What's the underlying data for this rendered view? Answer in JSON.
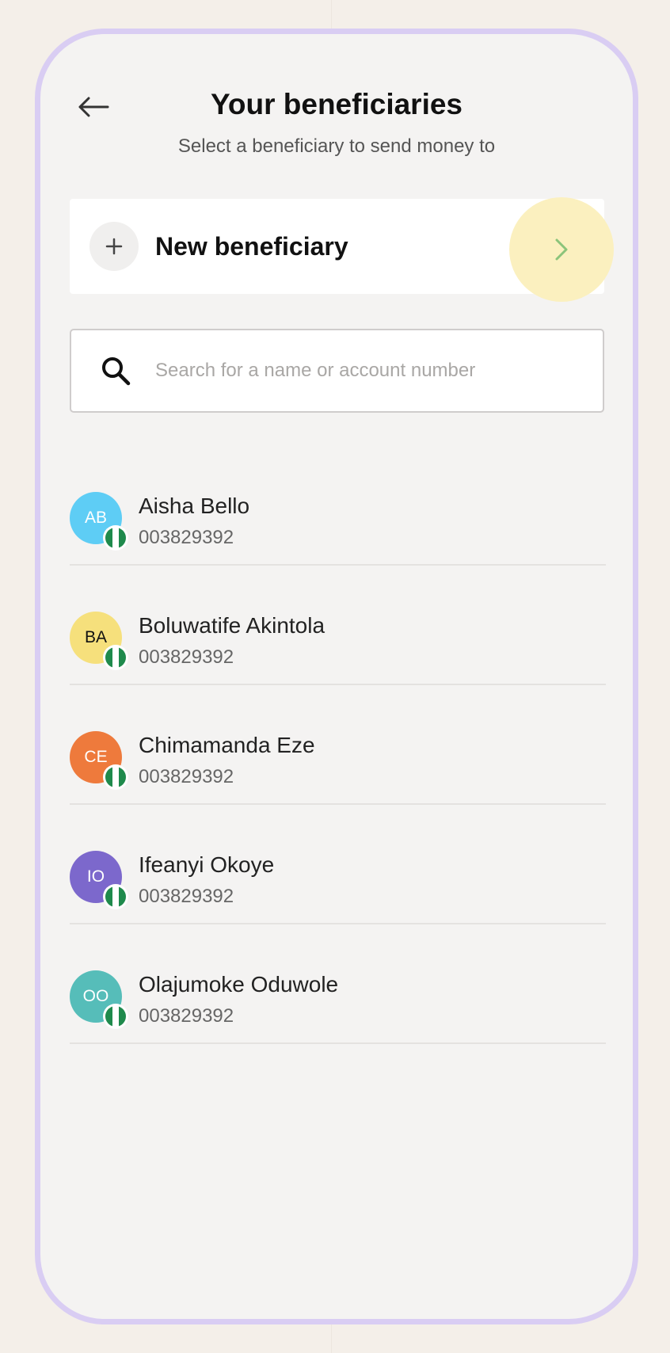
{
  "header": {
    "title": "Your beneficiaries",
    "subtitle": "Select a beneficiary to send money to"
  },
  "new_beneficiary": {
    "label": "New beneficiary",
    "icon": "plus-icon",
    "arrow_icon": "chevron-right-icon"
  },
  "search": {
    "placeholder": "Search for a name or account number",
    "value": ""
  },
  "beneficiaries": [
    {
      "initials": "AB",
      "name": "Aisha Bello",
      "account": "003829392",
      "color": "#5ecdf5",
      "text_color": "#ffffff"
    },
    {
      "initials": "BA",
      "name": "Boluwatife Akintola",
      "account": "003829392",
      "color": "#f6e07c",
      "text_color": "#111111"
    },
    {
      "initials": "CE",
      "name": "Chimamanda Eze",
      "account": "003829392",
      "color": "#ee7a3c",
      "text_color": "#ffffff"
    },
    {
      "initials": "IO",
      "name": "Ifeanyi Okoye",
      "account": "003829392",
      "color": "#7c68cc",
      "text_color": "#ffffff"
    },
    {
      "initials": "OO",
      "name": "Olajumoke Oduwole",
      "account": "003829392",
      "color": "#56bdb9",
      "text_color": "#ffffff"
    }
  ],
  "colors": {
    "phone_border": "#d9cdf3",
    "highlight": "#fbf0bf",
    "chevron": "#8bc47a",
    "flag_green": "#1f8a4c"
  }
}
